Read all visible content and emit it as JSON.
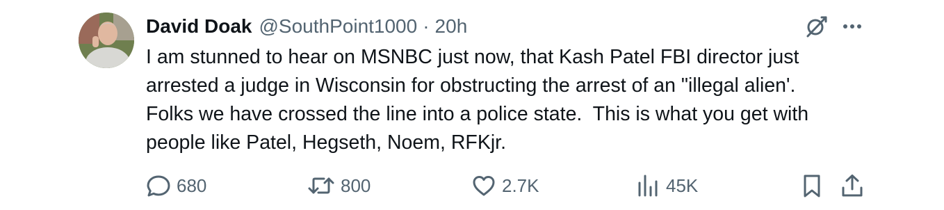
{
  "author": {
    "name": "David Doak",
    "handle": "@SouthPoint1000",
    "separator": "·",
    "time": "20h"
  },
  "tweet": {
    "text": "I am stunned to hear on MSNBC just now, that Kash Patel FBI director just\narrested a judge in Wisconsin for obstructing the arrest of an \"illegal alien'.\nFolks we have crossed the line into a police state.  This is what you get with\npeople like Patel, Hegseth, Noem, RFKjr."
  },
  "actions": {
    "replies": "680",
    "reposts": "800",
    "likes": "2.7K",
    "views": "45K"
  },
  "icons": {
    "header": [
      "grok-icon",
      "more-icon"
    ],
    "actions": [
      "reply-icon",
      "repost-icon",
      "like-icon",
      "views-icon",
      "bookmark-icon",
      "share-icon"
    ]
  },
  "colors": {
    "text": "#0f1419",
    "secondary": "#536471",
    "background": "#ffffff"
  }
}
